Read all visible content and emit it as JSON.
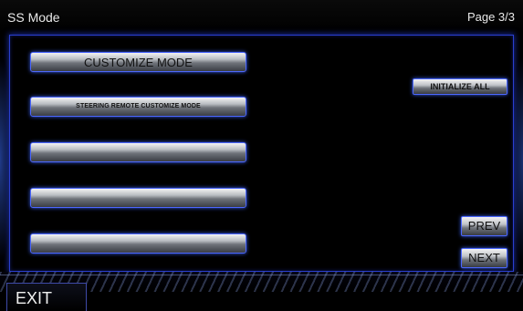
{
  "header": {
    "title": "SS Mode",
    "page_indicator": "Page 3/3"
  },
  "mode_list": {
    "items": [
      {
        "label": "CUSTOMIZE MODE"
      },
      {
        "label": "STEERING REMOTE CUSTOMIZE MODE"
      },
      {
        "label": ""
      },
      {
        "label": ""
      },
      {
        "label": ""
      }
    ]
  },
  "actions": {
    "initialize_all_label": "INITIALIZE ALL",
    "prev_label": "PREV",
    "next_label": "NEXT",
    "exit_label": "EXIT"
  },
  "colors": {
    "background": "#000000",
    "accent_blue": "#2a3fd0",
    "button_glow": "#4c68ff",
    "text_light": "#e8e8e8"
  }
}
